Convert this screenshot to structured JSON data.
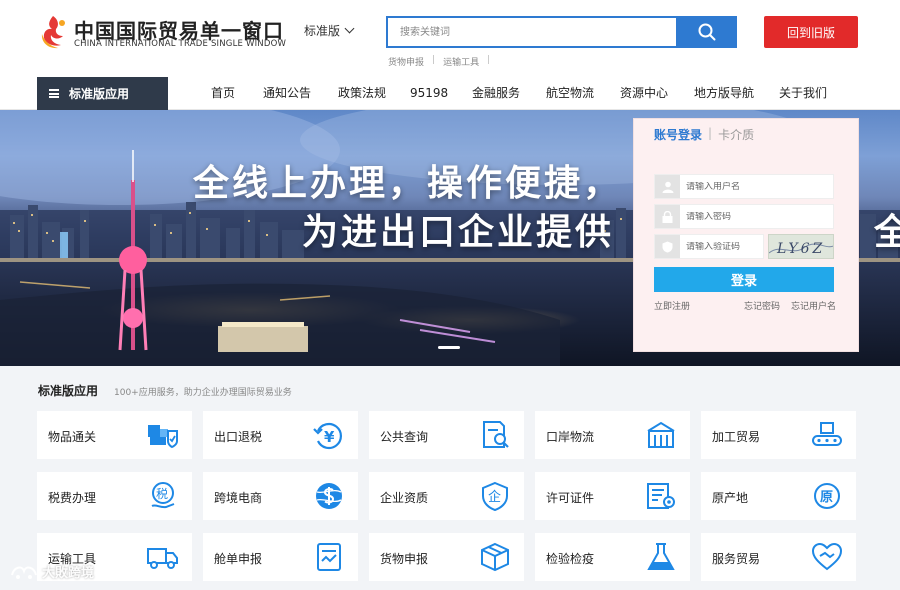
{
  "header": {
    "logo_cn": "中国国际贸易单一窗口",
    "logo_en": "CHINA INTERNATIONAL TRADE SINGLE WINDOW",
    "edition": "标准版",
    "search_placeholder": "搜索关键词",
    "quick_links": [
      "货物申报",
      "运输工具"
    ],
    "old_version": "回到旧版"
  },
  "nav": {
    "app_button": "标准版应用",
    "items": [
      "首页",
      "通知公告",
      "政策法规",
      "95198",
      "金融服务",
      "航空物流",
      "资源中心",
      "地方版导航",
      "关于我们"
    ]
  },
  "banner": {
    "line1": "全线上办理，操作便捷，",
    "line2": "为进出口企业提供",
    "edge": "全"
  },
  "login": {
    "tab_active": "账号登录",
    "tab_inactive": "卡介质",
    "username_placeholder": "请输入用户名",
    "password_placeholder": "请输入密码",
    "captcha_placeholder": "请输入验证码",
    "captcha_text": "LY6Z",
    "submit": "登录",
    "register": "立即注册",
    "forgot_password": "忘记密码",
    "forgot_username": "忘记用户名"
  },
  "apps": {
    "title": "标准版应用",
    "subtitle": "100+应用服务，助力企业办理国际贸易业务",
    "items": [
      {
        "label": "物品通关"
      },
      {
        "label": "出口退税"
      },
      {
        "label": "公共查询"
      },
      {
        "label": "口岸物流"
      },
      {
        "label": "加工贸易"
      },
      {
        "label": "税费办理"
      },
      {
        "label": "跨境电商"
      },
      {
        "label": "企业资质"
      },
      {
        "label": "许可证件"
      },
      {
        "label": "原产地"
      },
      {
        "label": "运输工具"
      },
      {
        "label": "舱单申报"
      },
      {
        "label": "货物申报"
      },
      {
        "label": "检验检疫"
      },
      {
        "label": "服务贸易"
      }
    ]
  },
  "icon_glyphs": {
    "tax": "税",
    "enterprise": "企",
    "origin": "原",
    "refund": "¥"
  },
  "watermark": "大敗跨境",
  "colors": {
    "brand_blue": "#2e7ad1",
    "icon_blue": "#1e88e5",
    "login_button": "#22a8ea",
    "old_version_red": "#e22a2a",
    "nav_dark": "#2f3a4a"
  }
}
